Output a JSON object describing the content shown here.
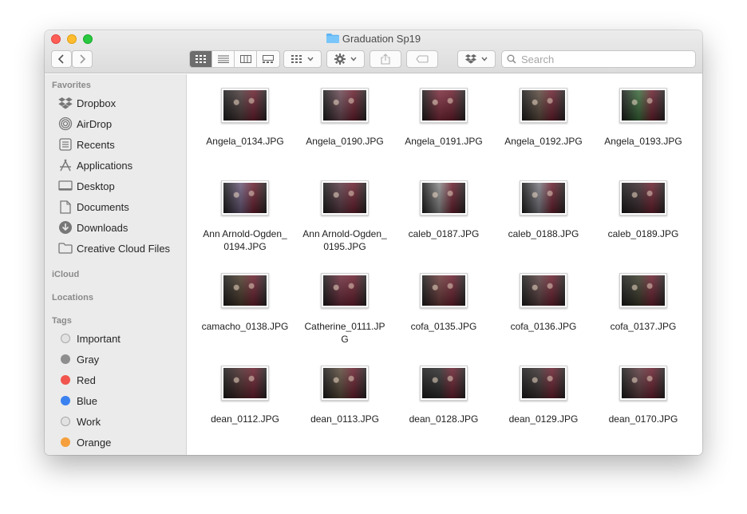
{
  "window": {
    "title": "Graduation Sp19",
    "search_placeholder": "Search"
  },
  "sidebar": {
    "favorites_header": "Favorites",
    "favorites": [
      {
        "label": "Dropbox",
        "icon": "dropbox-icon"
      },
      {
        "label": "AirDrop",
        "icon": "airdrop-icon"
      },
      {
        "label": "Recents",
        "icon": "recents-icon"
      },
      {
        "label": "Applications",
        "icon": "applications-icon"
      },
      {
        "label": "Desktop",
        "icon": "desktop-icon"
      },
      {
        "label": "Documents",
        "icon": "documents-icon"
      },
      {
        "label": "Downloads",
        "icon": "downloads-icon"
      },
      {
        "label": "Creative Cloud Files",
        "icon": "folder-icon"
      }
    ],
    "icloud_header": "iCloud",
    "locations_header": "Locations",
    "tags_header": "Tags",
    "tags": [
      {
        "label": "Important",
        "color": "#e2e2e2"
      },
      {
        "label": "Gray",
        "color": "#8e8e8e"
      },
      {
        "label": "Red",
        "color": "#f0554e"
      },
      {
        "label": "Blue",
        "color": "#3b82f0"
      },
      {
        "label": "Work",
        "color": "#e2e2e2"
      },
      {
        "label": "Orange",
        "color": "#f5a03c"
      }
    ]
  },
  "files": [
    {
      "name": "Angela_0134.JPG",
      "tone": "#4a3a3a"
    },
    {
      "name": "Angela_0190.JPG",
      "tone": "#6b4a55"
    },
    {
      "name": "Angela_0191.JPG",
      "tone": "#7a2a3a"
    },
    {
      "name": "Angela_0192.JPG",
      "tone": "#5a4a3e"
    },
    {
      "name": "Angela_0193.JPG",
      "tone": "#3a6a3a"
    },
    {
      "name": "Ann Arnold-Ogden_0194.JPG",
      "tone": "#6a5a7a"
    },
    {
      "name": "Ann Arnold-Ogden_0195.JPG",
      "tone": "#5a3a45"
    },
    {
      "name": "caleb_0187.JPG",
      "tone": "#8a8a8a"
    },
    {
      "name": "caleb_0188.JPG",
      "tone": "#7a7a82"
    },
    {
      "name": "caleb_0189.JPG",
      "tone": "#3a2a2e"
    },
    {
      "name": "camacho_0138.JPG",
      "tone": "#4a3a2a"
    },
    {
      "name": "Catherine_0111.JPG",
      "tone": "#6a2a3a"
    },
    {
      "name": "cofa_0135.JPG",
      "tone": "#6a3a3a"
    },
    {
      "name": "cofa_0136.JPG",
      "tone": "#5a4040"
    },
    {
      "name": "cofa_0137.JPG",
      "tone": "#3a3a2a"
    },
    {
      "name": "dean_0112.JPG",
      "tone": "#4a2a2a"
    },
    {
      "name": "dean_0113.JPG",
      "tone": "#5a4a3a"
    },
    {
      "name": "dean_0128.JPG",
      "tone": "#2a2a2a"
    },
    {
      "name": "dean_0129.JPG",
      "tone": "#3a3030"
    },
    {
      "name": "dean_0170.JPG",
      "tone": "#5a3a3e"
    }
  ]
}
